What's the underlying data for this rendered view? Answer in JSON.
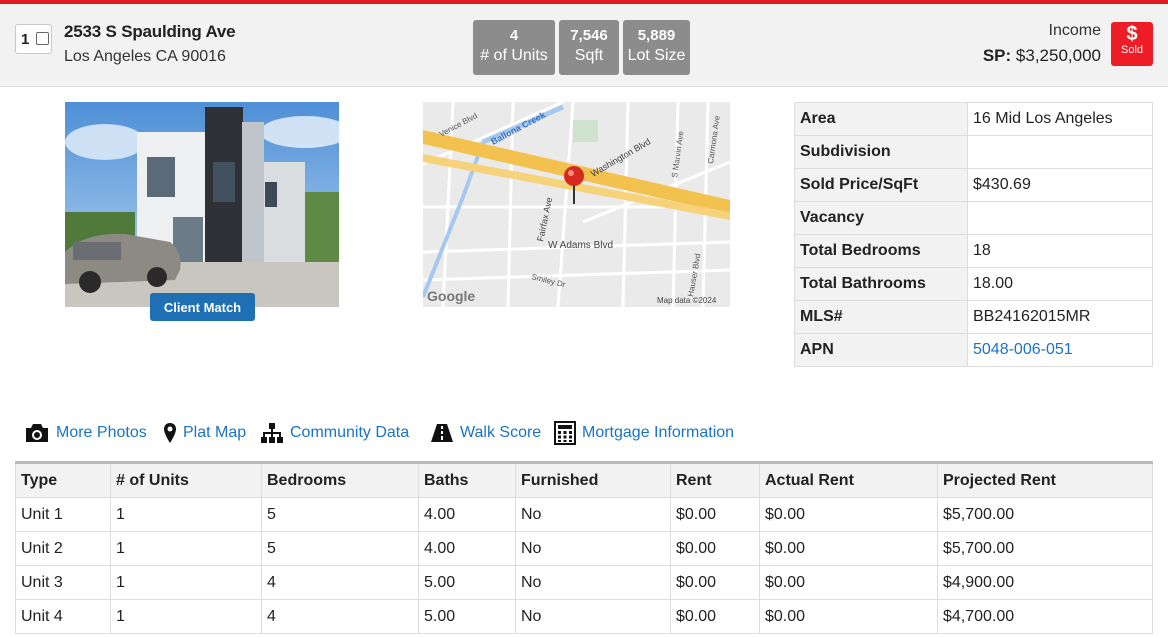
{
  "listing": {
    "index": "1",
    "address_line1": "2533 S Spaulding Ave",
    "address_line2": "Los Angeles CA 90016"
  },
  "stats": [
    {
      "value": "4",
      "label": "# of Units"
    },
    {
      "value": "7,546",
      "label": "Sqft"
    },
    {
      "value": "5,889",
      "label": "Lot Size"
    }
  ],
  "price": {
    "category": "Income",
    "sp_label": "SP:",
    "sp_value": "$3,250,000",
    "status_icon": "dollar-icon",
    "status_symbol": "$",
    "status_text": "Sold",
    "status_color": "#ee1c24"
  },
  "client_match_label": "Client Match",
  "map": {
    "labels": [
      "Venice Blvd",
      "Ballona Creek",
      "Washington Blvd",
      "S Marvin Ave",
      "Carmona Ave",
      "Fairfax Ave",
      "W Adams Blvd",
      "Smiley Dr",
      "Hauser Blvd"
    ],
    "logo": "Google",
    "attribution": "Map data ©2024"
  },
  "details": [
    {
      "key": "Area",
      "value": "16 Mid Los Angeles"
    },
    {
      "key": "Subdivision",
      "value": ""
    },
    {
      "key": "Sold Price/SqFt",
      "value": "$430.69"
    },
    {
      "key": "Vacancy",
      "value": ""
    },
    {
      "key": "Total Bedrooms",
      "value": "18"
    },
    {
      "key": "Total Bathrooms",
      "value": "18.00"
    },
    {
      "key": "MLS#",
      "value": "BB24162015MR"
    },
    {
      "key": "APN",
      "value": "5048-006-051"
    }
  ],
  "links": [
    {
      "icon": "camera-icon",
      "label": "More Photos"
    },
    {
      "icon": "map-pin-icon",
      "label": "Plat Map"
    },
    {
      "icon": "sitemap-icon",
      "label": "Community Data"
    },
    {
      "icon": "road-icon",
      "label": "Walk Score"
    },
    {
      "icon": "calculator-icon",
      "label": "Mortgage Information"
    }
  ],
  "units_table": {
    "headers": [
      "Type",
      "# of Units",
      "Bedrooms",
      "Baths",
      "Furnished",
      "Rent",
      "Actual Rent",
      "Projected Rent"
    ],
    "rows": [
      [
        "Unit 1",
        "1",
        "5",
        "4.00",
        "No",
        "$0.00",
        "$0.00",
        "$5,700.00"
      ],
      [
        "Unit 2",
        "1",
        "5",
        "4.00",
        "No",
        "$0.00",
        "$0.00",
        "$5,700.00"
      ],
      [
        "Unit 3",
        "1",
        "4",
        "5.00",
        "No",
        "$0.00",
        "$0.00",
        "$4,900.00"
      ],
      [
        "Unit 4",
        "1",
        "4",
        "5.00",
        "No",
        "$0.00",
        "$0.00",
        "$4,700.00"
      ]
    ]
  }
}
